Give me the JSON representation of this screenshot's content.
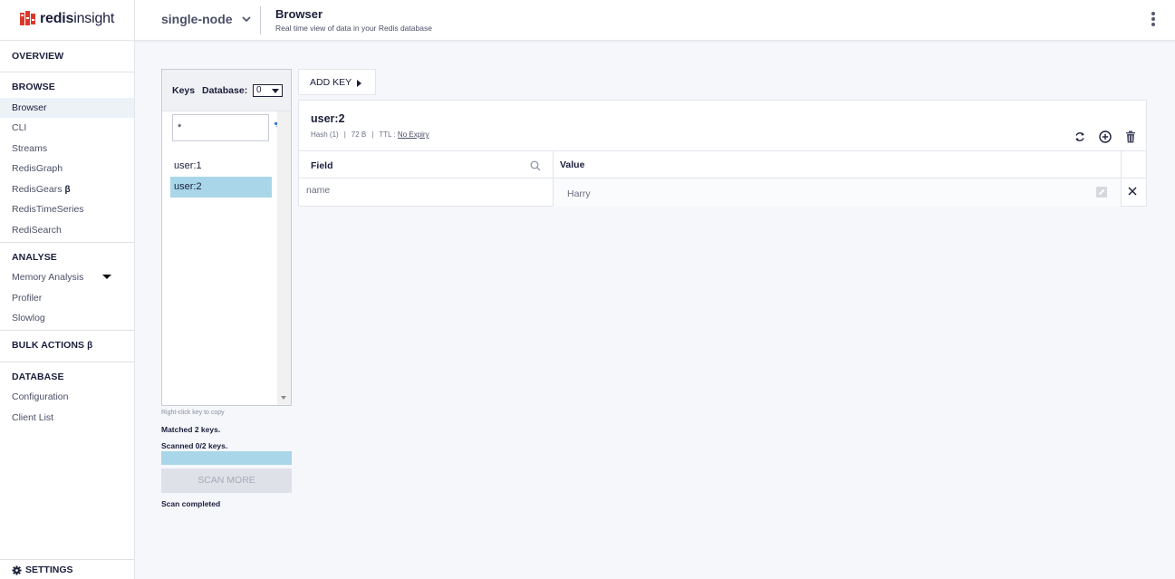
{
  "header": {
    "logo_bold": "redis",
    "logo_light": "insight",
    "database_name": "single-node",
    "title": "Browser",
    "subtitle": "Real time view of data in your Redis database"
  },
  "sidebar": {
    "overview": "OVERVIEW",
    "browse": {
      "heading": "BROWSE",
      "items": [
        "Browser",
        "CLI",
        "Streams",
        "RedisGraph",
        "RedisGears",
        "RedisTimeSeries",
        "RediSearch"
      ],
      "beta": "β"
    },
    "analyse": {
      "heading": "ANALYSE",
      "items": [
        "Memory Analysis",
        "Profiler",
        "Slowlog"
      ]
    },
    "bulk_actions": "BULK ACTIONS",
    "bulk_beta": "β",
    "database": {
      "heading": "DATABASE",
      "items": [
        "Configuration",
        "Client List"
      ]
    },
    "settings": "SETTINGS"
  },
  "keys_panel": {
    "keys_label": "Keys",
    "database_label": "Database:",
    "database_value": "0",
    "pattern_value": "*",
    "keys": [
      "user:1",
      "user:2"
    ],
    "selected_index": 1,
    "hint": "Right-click key to copy",
    "matched": "Matched 2 keys.",
    "scanned": "Scanned 0/2 keys.",
    "progress_fraction": 1.0,
    "scan_more": "SCAN MORE",
    "scan_status": "Scan completed"
  },
  "add_key": "ADD KEY",
  "details": {
    "key_name": "user:2",
    "type": "Hash (1)",
    "size": "72 B",
    "ttl_label": "TTL :",
    "ttl_value": "No Expiry",
    "separator": "|",
    "columns": {
      "field": "Field",
      "value": "Value"
    },
    "rows": [
      {
        "field": "name",
        "value": "Harry"
      }
    ]
  },
  "colors": {
    "brand_red": "#dc382c",
    "selected_key": "#a9d6e8",
    "filter_blue": "#3a7bd5"
  }
}
